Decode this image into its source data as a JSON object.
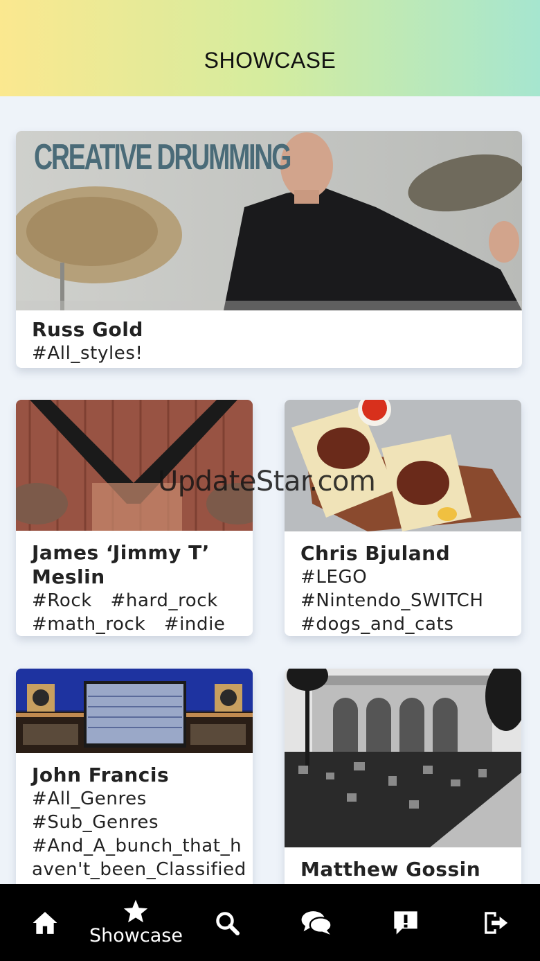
{
  "header": {
    "title": "SHOWCASE"
  },
  "cards": [
    {
      "name": "Russ Gold",
      "tags": "#All_styles!",
      "image_text": "CREATIVE DRUMMING"
    },
    {
      "name": "James ‘Jimmy T’ Meslin",
      "tags": "#Rock   #hard_rock\n#math_rock   #indie"
    },
    {
      "name": "Chris Bjuland",
      "tags": "#LEGO\n#Nintendo_SWITCH\n#dogs_and_cats"
    },
    {
      "name": "John Francis",
      "tags": "#All_Genres\n#Sub_Genres\n#And_A_bunch_that_haven't_been_Classified"
    },
    {
      "name": "Matthew Gossin",
      "tags": ""
    }
  ],
  "watermark": "UpdateStar.com",
  "tabbar": {
    "items": [
      {
        "icon": "home-icon",
        "label": ""
      },
      {
        "icon": "star-icon",
        "label": "Showcase",
        "active": true
      },
      {
        "icon": "search-icon",
        "label": ""
      },
      {
        "icon": "chat-icon",
        "label": ""
      },
      {
        "icon": "alert-icon",
        "label": ""
      },
      {
        "icon": "logout-icon",
        "label": ""
      }
    ]
  },
  "colors": {
    "tabbar_bg": "#000000",
    "header_left": "#fbe88f",
    "header_right": "#a6e6cf",
    "page_bg": "#eef3f9"
  }
}
